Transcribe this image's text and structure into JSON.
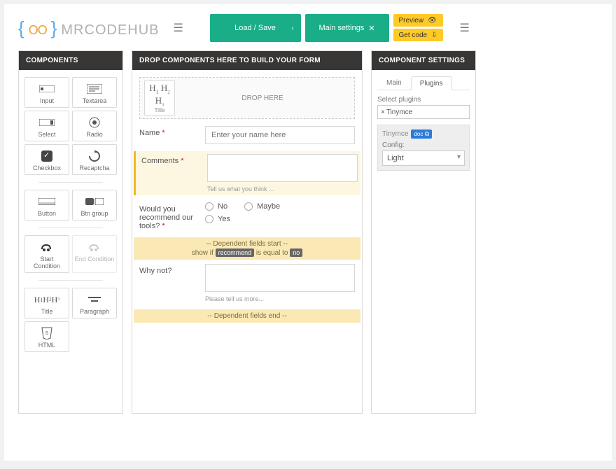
{
  "logo": {
    "text": "MRCODEHUB"
  },
  "toolbar": {
    "load_save": "Load / Save",
    "main_settings": "Main settings",
    "preview": "Preview",
    "get_code": "Get code"
  },
  "panels": {
    "components_title": "COMPONENTS",
    "builder_title": "DROP COMPONENTS HERE TO BUILD YOUR FORM",
    "settings_title": "COMPONENT SETTINGS"
  },
  "components": [
    {
      "label": "Input",
      "icon": "input-icon"
    },
    {
      "label": "Textarea",
      "icon": "textarea-icon"
    },
    {
      "label": "Select",
      "icon": "select-icon"
    },
    {
      "label": "Radio",
      "icon": "radio-icon"
    },
    {
      "label": "Checkbox",
      "icon": "checkbox-icon"
    },
    {
      "label": "Recaptcha",
      "icon": "recaptcha-icon"
    },
    {
      "label": "Button",
      "icon": "button-icon"
    },
    {
      "label": "Btn group",
      "icon": "btngroup-icon"
    },
    {
      "label": "Start Condition",
      "icon": "start-cond-icon"
    },
    {
      "label": "End Condition",
      "icon": "end-cond-icon"
    },
    {
      "label": "Title",
      "icon": "title-icon"
    },
    {
      "label": "Paragraph",
      "icon": "paragraph-icon"
    },
    {
      "label": "HTML",
      "icon": "html-icon"
    }
  ],
  "builder": {
    "drop_here": "DROP HERE",
    "tile_label": "Title",
    "fields": {
      "name": {
        "label": "Name",
        "placeholder": "Enter your name here"
      },
      "comments": {
        "label": "Comments",
        "help": "Tell us what you think ..."
      },
      "recommend": {
        "label": "Would you recommend our tools?",
        "options": [
          "No",
          "Maybe",
          "Yes"
        ]
      },
      "whynot": {
        "label": "Why not?",
        "help": "Please tell us more..."
      }
    },
    "dep_start": "-- Dependent fields start --",
    "dep_cond_prefix": "show if",
    "dep_cond_field": "recommend",
    "dep_cond_mid": "is equal to",
    "dep_cond_value": "no",
    "dep_end": "-- Dependent fields end --"
  },
  "settings": {
    "tabs": [
      "Main",
      "Plugins"
    ],
    "active_tab": 1,
    "select_plugins_label": "Select plugins",
    "plugin_chip": "Tinymce",
    "plugin_name": "Tinymce",
    "doc_label": "doc",
    "config_label": "Config:",
    "config_value": "Light"
  }
}
